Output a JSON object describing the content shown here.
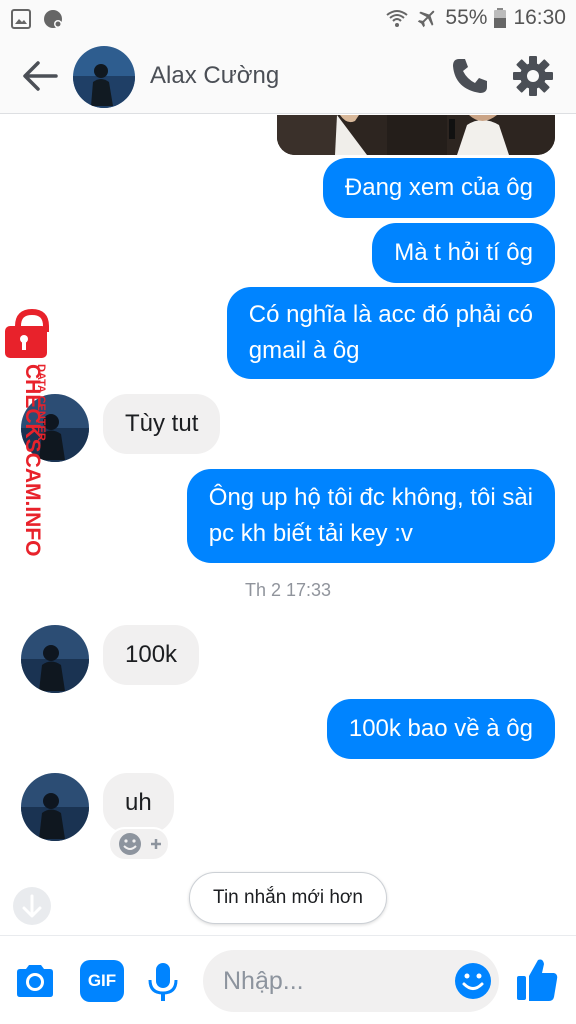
{
  "status_bar": {
    "battery": "55%",
    "time": "16:30"
  },
  "header": {
    "contact_name": "Alax Cường",
    "icons": [
      "back-arrow-icon",
      "phone-icon",
      "gear-icon"
    ]
  },
  "messages": [
    {
      "from": "me",
      "text": "Đang xem của ôg"
    },
    {
      "from": "me",
      "text": "Mà t hỏi tí ôg"
    },
    {
      "from": "me",
      "lines": [
        "Có nghĩa là acc đó phải có",
        "gmail à ôg"
      ]
    },
    {
      "from": "them",
      "text": "Tùy tut"
    },
    {
      "from": "me",
      "lines": [
        "Ông up hộ tôi đc không, tôi sài",
        "pc kh biết tải key :v"
      ]
    },
    {
      "from": "them",
      "text": "100k"
    },
    {
      "from": "me",
      "text": "100k bao về à ôg"
    },
    {
      "from": "them",
      "text": "uh"
    }
  ],
  "timestamp": "Th 2 17:33",
  "newer_messages_label": "Tin nhắn mới hơn",
  "watermark": {
    "text": "CHECKSCAM.INFO",
    "sub": "DATA CENTER"
  },
  "composer": {
    "placeholder": "Nhập...",
    "gif_label": "GIF"
  },
  "colors": {
    "accent": "#0084ff",
    "incoming_bubble": "#f1f0f0",
    "watermark": "#e8222b"
  }
}
